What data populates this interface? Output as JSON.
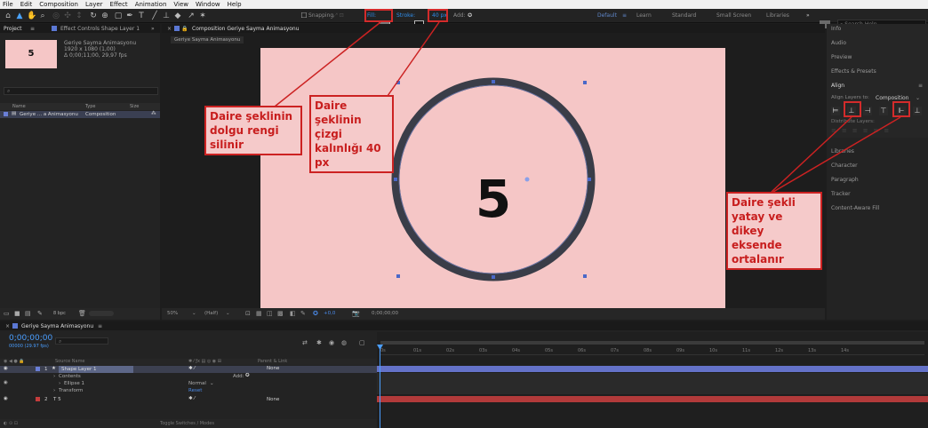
{
  "menu": [
    "File",
    "Edit",
    "Composition",
    "Layer",
    "Effect",
    "Animation",
    "View",
    "Window",
    "Help"
  ],
  "toolbar": {
    "snapping": "Snapping",
    "fill_label": "Fill:",
    "stroke_label": "Stroke:",
    "stroke_px": "40 px",
    "add_label": "Add:",
    "workspaces": [
      "Default",
      "Learn",
      "Standard",
      "Small Screen",
      "Libraries"
    ],
    "search_placeholder": "Search Help"
  },
  "project_panel": {
    "tab_project": "Project",
    "tab_effect_controls": "Effect Controls Shape Layer 1",
    "thumb_number": "5",
    "comp_name": "Geriye Sayma Animasyonu",
    "comp_line2": "1920 x 1080 (1,00)",
    "comp_line3": "Δ 0;00;11;00, 29,97 fps",
    "col_name": "Name",
    "col_type": "Type",
    "col_size": "Size",
    "row_name": "Geriye ... a Animasyonu",
    "row_type": "Composition",
    "footer_bpc": "8 bpc"
  },
  "comp_viewer": {
    "tab_label": "Composition Geriye Sayma Animasyonu",
    "sub_tab": "Geriye Sayma Animasyonu",
    "canvas_number": "5",
    "zoom": "50%",
    "resolution": "(Half)",
    "timecode": "0;00;00;00",
    "offset": "+0,0"
  },
  "right_panel": {
    "items": [
      "Info",
      "Audio",
      "Preview",
      "Effects & Presets",
      "Align",
      "Libraries",
      "Character",
      "Paragraph",
      "Tracker",
      "Content-Aware Fill"
    ],
    "align_to_label": "Align Layers to:",
    "align_to_value": "Composition",
    "distribute_label": "Distribute Layers:"
  },
  "timeline": {
    "tab_label": "Geriye Sayma Animasyonu",
    "timecode": "0;00;00;00",
    "timecode_sub": "00000 (29.97 fps)",
    "col_source_name": "Source Name",
    "col_parent": "Parent & Link",
    "layers": [
      {
        "index": "1",
        "name": "Shape Layer 1",
        "parent": "None"
      },
      {
        "index": "",
        "name": "Contents",
        "parent": ""
      },
      {
        "index": "",
        "name": "Ellipse 1",
        "parent": "Normal"
      },
      {
        "index": "",
        "name": "Transform",
        "parent": "Reset"
      },
      {
        "index": "2",
        "name": "T 5",
        "parent": "None"
      }
    ],
    "add_label": "Add:",
    "ruler": [
      "0s",
      "01s",
      "02s",
      "03s",
      "04s",
      "05s",
      "06s",
      "07s",
      "08s",
      "09s",
      "10s",
      "11s",
      "12s",
      "13s",
      "14s"
    ],
    "footer": "Toggle Switches / Modes"
  },
  "callouts": {
    "fill": "Daire şeklinin dolgu rengi silinir",
    "stroke": "Daire şeklinin çizgi kalınlığı 40 px",
    "align": "Daire şekli yatay ve dikey eksende ortalanır"
  },
  "colors": {
    "canvas_bg": "#f5c6c6",
    "circle_stroke": "#3a3d48",
    "accent_blue": "#2d8ceb",
    "callout_red": "#cc2222",
    "layer_label_blue": "#6a7fd8",
    "layer_label_red": "#c43c3c"
  }
}
